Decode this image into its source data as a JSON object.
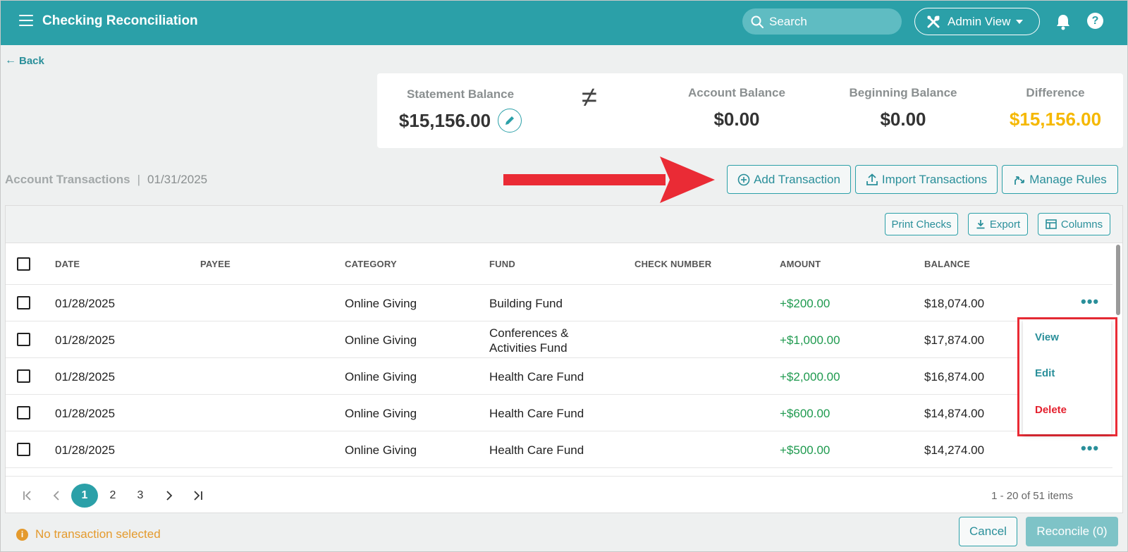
{
  "header": {
    "title": "Checking Reconciliation",
    "search_placeholder": "Search",
    "admin_view_label": "Admin View",
    "help_label": "?"
  },
  "nav": {
    "back_label": "Back"
  },
  "summary": {
    "statement_balance_label": "Statement Balance",
    "statement_balance_value": "$15,156.00",
    "not_equal_symbol": "≠",
    "account_balance_label": "Account Balance",
    "account_balance_value": "$0.00",
    "beginning_balance_label": "Beginning Balance",
    "beginning_balance_value": "$0.00",
    "difference_label": "Difference",
    "difference_value": "$15,156.00"
  },
  "transactions": {
    "section_title": "Account Transactions",
    "separator": "|",
    "date": "01/31/2025",
    "add_transaction_label": "Add Transaction",
    "import_transactions_label": "Import Transactions",
    "manage_rules_label": "Manage Rules",
    "print_checks_label": "Print Checks",
    "export_label": "Export",
    "columns_label": "Columns"
  },
  "table": {
    "columns": {
      "date": "DATE",
      "payee": "PAYEE",
      "category": "CATEGORY",
      "fund": "FUND",
      "check_number": "CHECK NUMBER",
      "amount": "AMOUNT",
      "balance": "BALANCE"
    },
    "rows": [
      {
        "date": "01/28/2025",
        "payee": "",
        "category": "Online Giving",
        "fund_line1": "Building Fund",
        "fund_line2": "",
        "check_number": "",
        "amount": "+$200.00",
        "balance": "$18,074.00"
      },
      {
        "date": "01/28/2025",
        "payee": "",
        "category": "Online Giving",
        "fund_line1": "Conferences &",
        "fund_line2": "Activities Fund",
        "check_number": "",
        "amount": "+$1,000.00",
        "balance": "$17,874.00"
      },
      {
        "date": "01/28/2025",
        "payee": "",
        "category": "Online Giving",
        "fund_line1": "Health Care Fund",
        "fund_line2": "",
        "check_number": "",
        "amount": "+$2,000.00",
        "balance": "$16,874.00"
      },
      {
        "date": "01/28/2025",
        "payee": "",
        "category": "Online Giving",
        "fund_line1": "Health Care Fund",
        "fund_line2": "",
        "check_number": "",
        "amount": "+$600.00",
        "balance": "$14,874.00"
      },
      {
        "date": "01/28/2025",
        "payee": "",
        "category": "Online Giving",
        "fund_line1": "Health Care Fund",
        "fund_line2": "",
        "check_number": "",
        "amount": "+$500.00",
        "balance": "$14,274.00"
      }
    ],
    "row_menu_glyph": "•••"
  },
  "context_menu": {
    "view_label": "View",
    "edit_label": "Edit",
    "delete_label": "Delete"
  },
  "pagination": {
    "pages": [
      "1",
      "2",
      "3"
    ],
    "current_page": "1",
    "info": "1 - 20 of 51 items"
  },
  "footer": {
    "status": "No transaction selected",
    "cancel_label": "Cancel",
    "reconcile_label": "Reconcile (0)"
  },
  "colors": {
    "brand": "#2ba0a8",
    "amount_positive": "#1f9a4f",
    "difference": "#f5b800",
    "delete": "#e4202e",
    "warning": "#e49a2d",
    "annotation_red": "#ea2b35"
  },
  "icons": {
    "menu": "hamburger-icon",
    "search": "search-icon",
    "admin": "tools-icon",
    "notifications": "bell-icon",
    "help": "help-icon",
    "edit": "pencil-icon",
    "add": "plus-circle-icon",
    "import": "upload-icon",
    "rules": "rules-icon",
    "export": "download-icon",
    "columns": "columns-icon",
    "status": "info-icon"
  }
}
